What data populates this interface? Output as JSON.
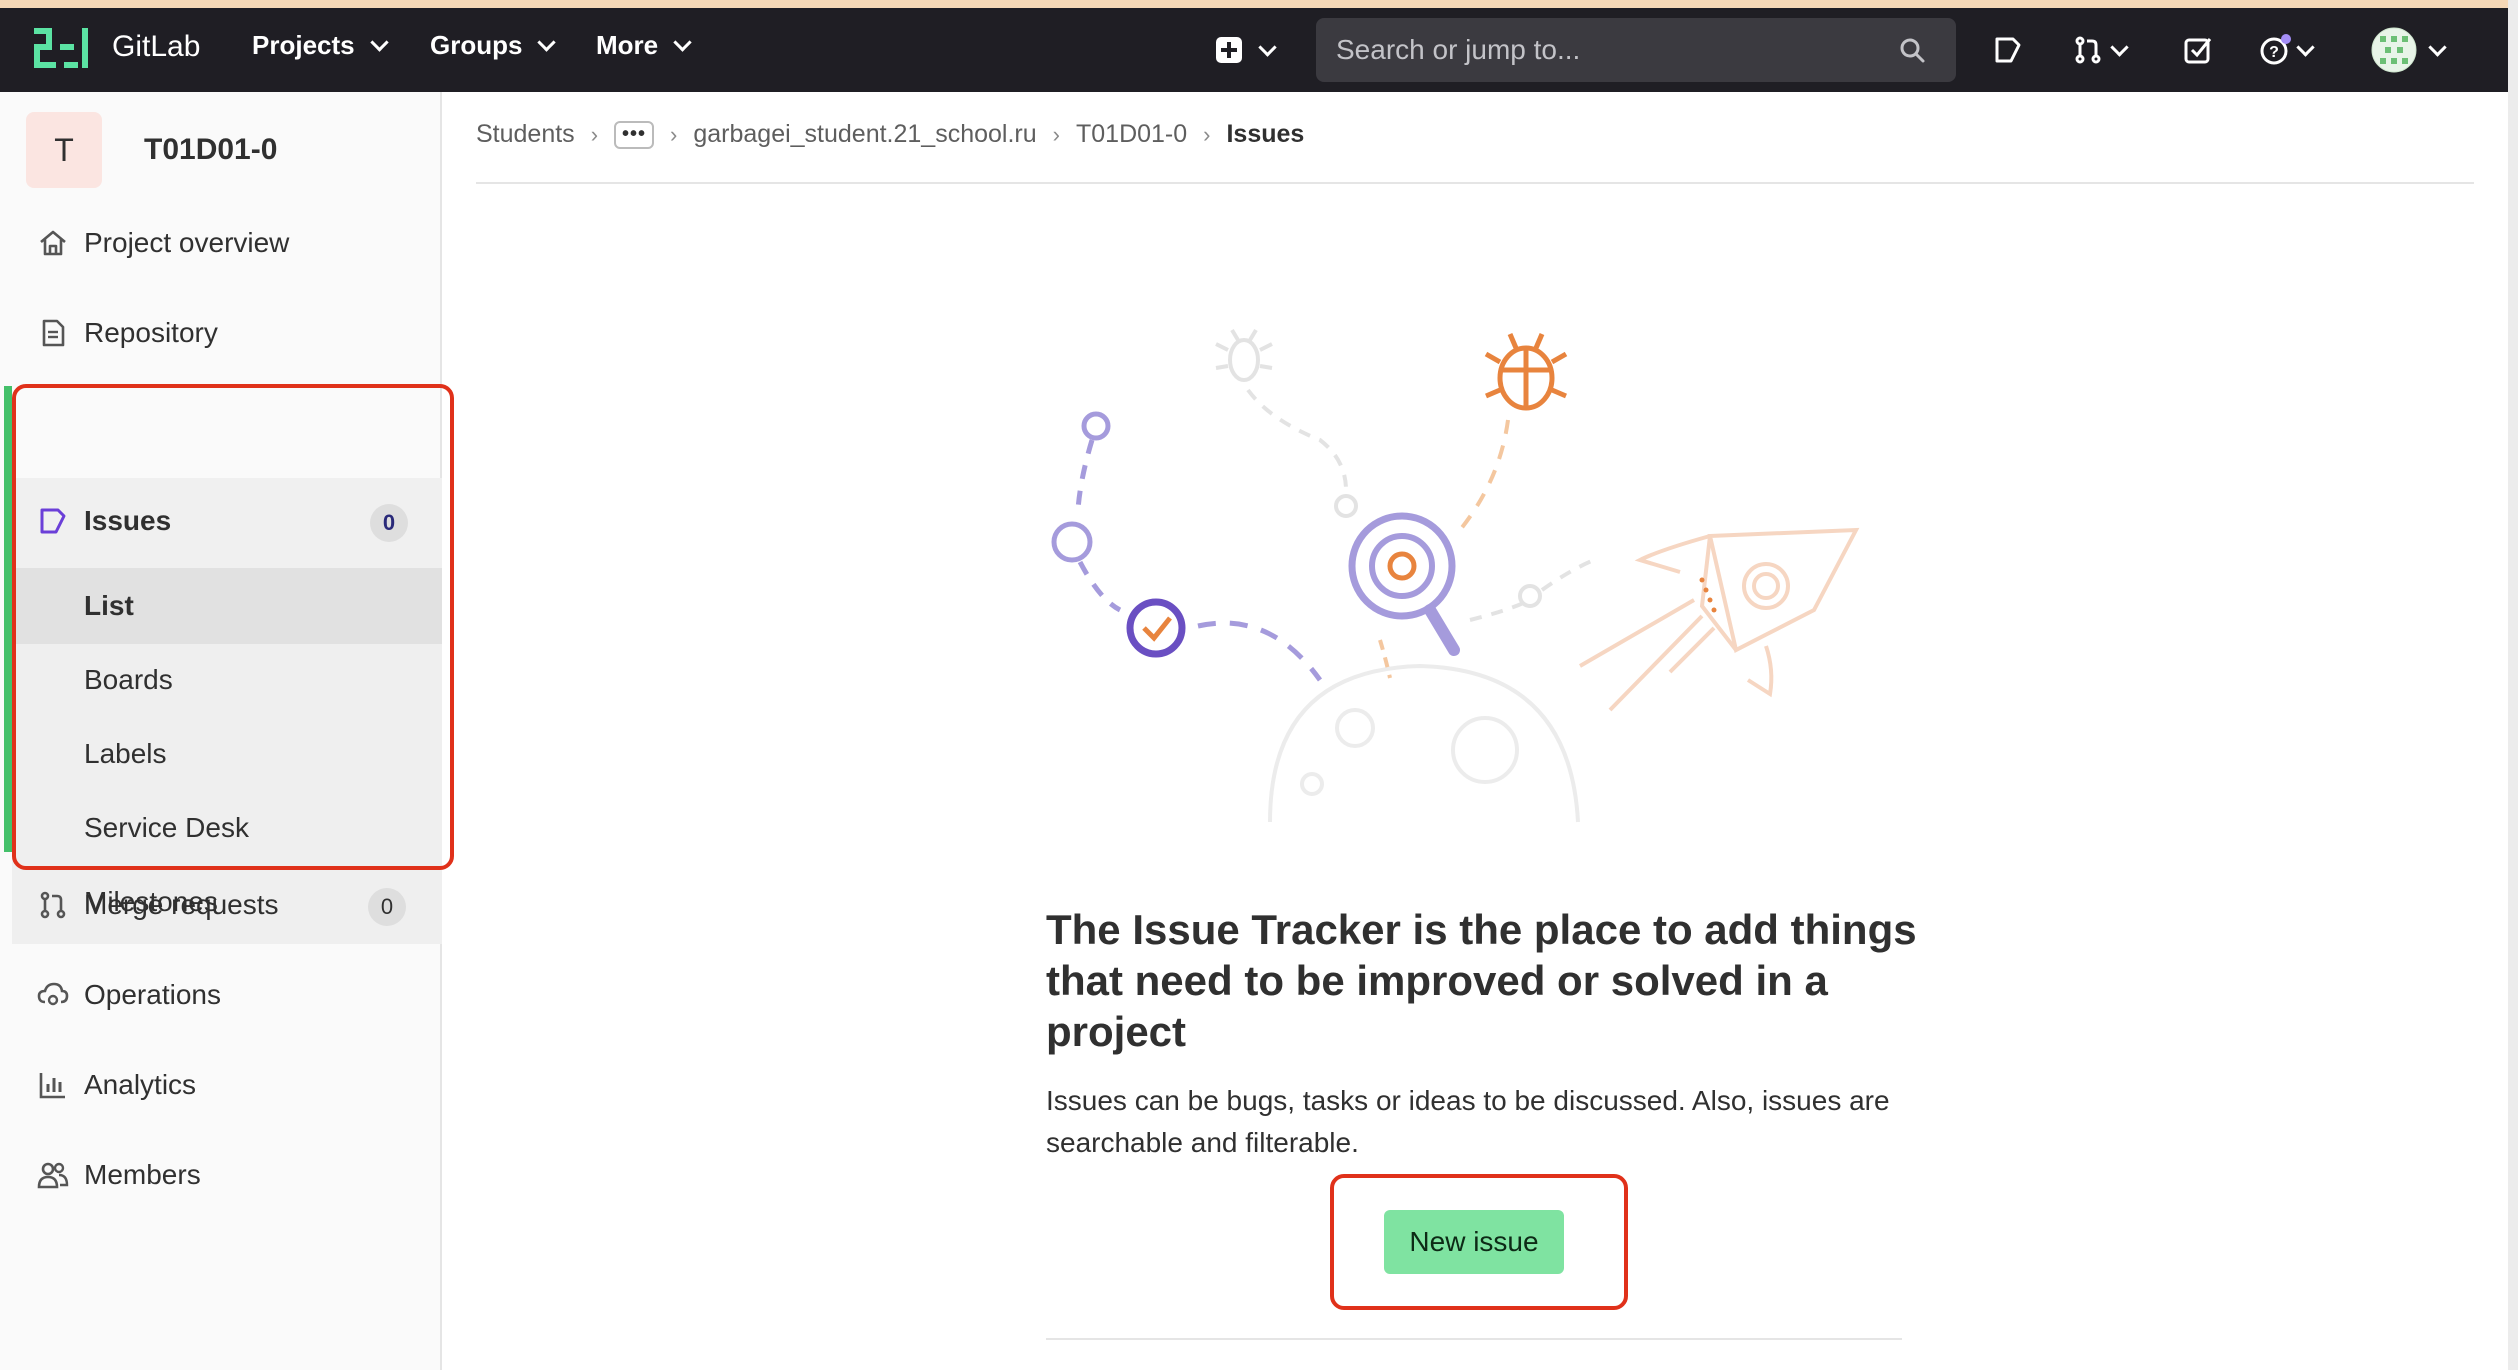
{
  "navbar": {
    "brand": "GitLab",
    "menus": [
      "Projects",
      "Groups",
      "More"
    ],
    "search_placeholder": "Search or jump to..."
  },
  "sidebar": {
    "project_initial": "T",
    "project_name": "T01D01-0",
    "items": [
      {
        "label": "Project overview",
        "icon": "home-icon"
      },
      {
        "label": "Repository",
        "icon": "file-icon"
      },
      {
        "label": "Issues",
        "icon": "issues-icon",
        "count": "0"
      },
      {
        "label": "Merge requests",
        "icon": "merge-request-icon",
        "count": "0"
      },
      {
        "label": "Operations",
        "icon": "cloud-gear-icon"
      },
      {
        "label": "Analytics",
        "icon": "chart-icon"
      },
      {
        "label": "Members",
        "icon": "users-icon"
      }
    ],
    "issues_subitems": [
      "List",
      "Boards",
      "Labels",
      "Service Desk",
      "Milestones"
    ]
  },
  "breadcrumb": {
    "items": [
      "Students",
      "garbagei_student.21_school.ru",
      "T01D01-0"
    ],
    "current": "Issues"
  },
  "empty_state": {
    "title": "The Issue Tracker is the place to add things that need to be improved or solved in a project",
    "description": "Issues can be bugs, tasks or ideas to be discussed. Also, issues are searchable and filterable.",
    "button": "New issue"
  },
  "colors": {
    "navbar": "#1f1e24",
    "primary_button": "#7fe3a1",
    "highlight": "#e0311a",
    "accent_green": "#44c06a"
  }
}
